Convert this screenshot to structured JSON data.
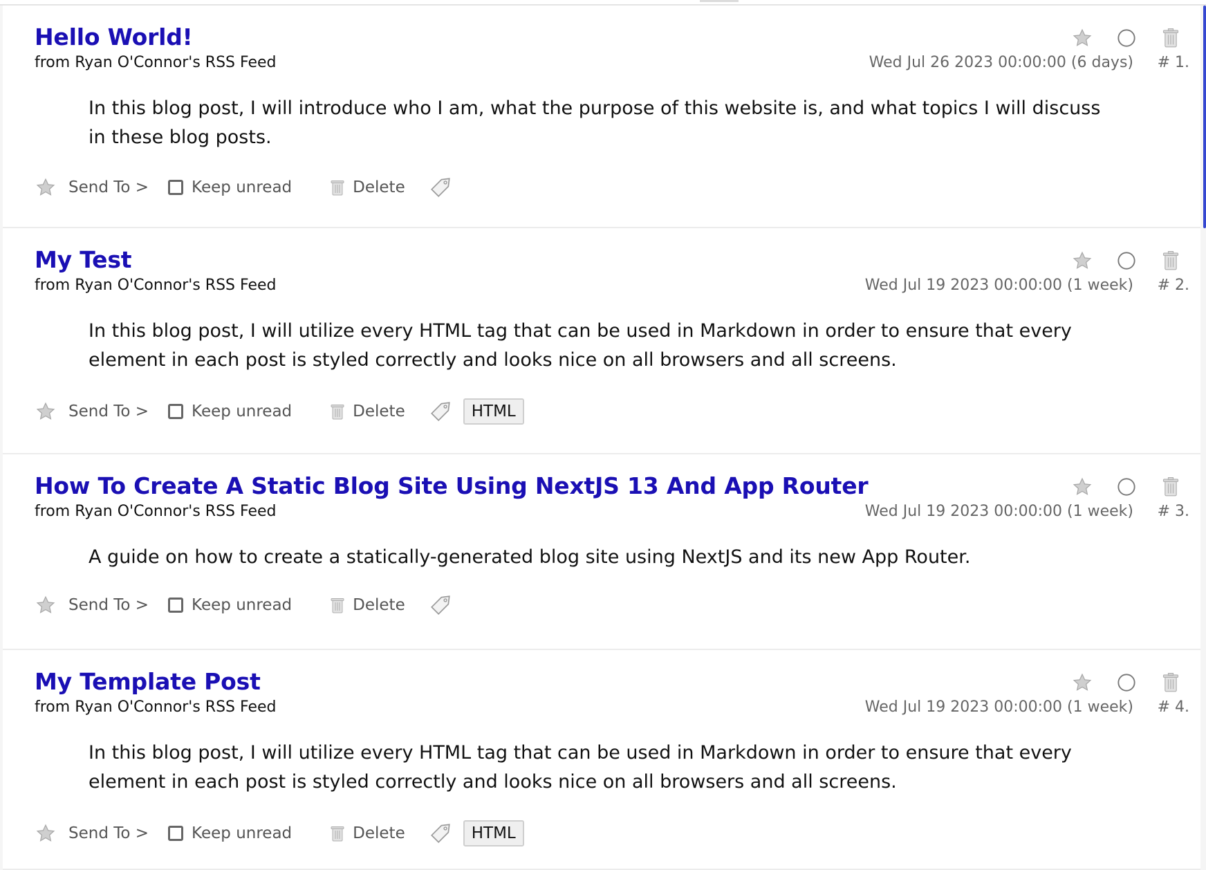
{
  "colors": {
    "title": "#1a0fb4",
    "active_indicator": "#3547d0",
    "meta_text": "#666666"
  },
  "icons": {
    "header": [
      "star-icon",
      "circle-icon",
      "trash-icon"
    ],
    "footer": [
      "star-icon",
      "checkbox",
      "trash-icon",
      "tag-icon"
    ]
  },
  "footer_labels": {
    "send_to": "Send To >",
    "keep_unread": "Keep unread",
    "delete": "Delete"
  },
  "articles": [
    {
      "title": "Hello World!",
      "source": "from Ryan O'Connor's RSS Feed",
      "date": "Wed Jul 26 2023 00:00:00 (6 days)",
      "number": "# 1.",
      "summary": "In this blog post, I will introduce who I am, what the purpose of this website is, and what topics I will discuss in these blog posts.",
      "tag": ""
    },
    {
      "title": "My Test",
      "source": "from Ryan O'Connor's RSS Feed",
      "date": "Wed Jul 19 2023 00:00:00 (1 week)",
      "number": "# 2.",
      "summary": "In this blog post, I will utilize every HTML tag that can be used in Markdown in order to ensure that every element in each post is styled correctly and looks nice on all browsers and all screens.",
      "tag": "HTML"
    },
    {
      "title": "How To Create A Static Blog Site Using NextJS 13 And App Router",
      "source": "from Ryan O'Connor's RSS Feed",
      "date": "Wed Jul 19 2023 00:00:00 (1 week)",
      "number": "# 3.",
      "summary": "A guide on how to create a statically-generated blog site using NextJS and its new App Router.",
      "tag": ""
    },
    {
      "title": "My Template Post",
      "source": "from Ryan O'Connor's RSS Feed",
      "date": "Wed Jul 19 2023 00:00:00 (1 week)",
      "number": "# 4.",
      "summary": "In this blog post, I will utilize every HTML tag that can be used in Markdown in order to ensure that every element in each post is styled correctly and looks nice on all browsers and all screens.",
      "tag": "HTML"
    }
  ]
}
